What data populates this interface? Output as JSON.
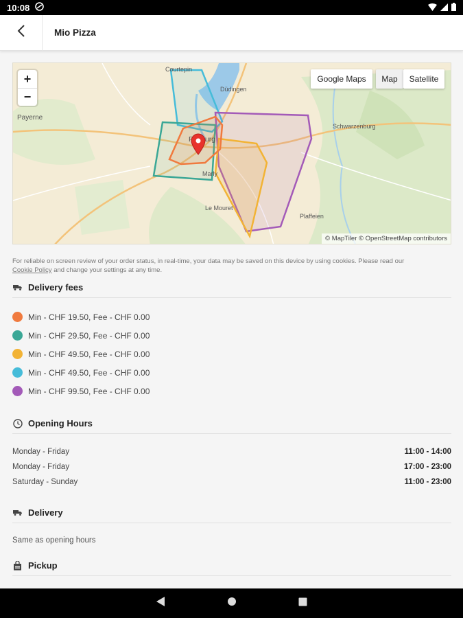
{
  "status_bar": {
    "time": "10:08"
  },
  "app_bar": {
    "title": "Mio Pizza"
  },
  "map": {
    "zoom_in": "+",
    "zoom_out": "−",
    "google_maps_label": "Google Maps",
    "map_label": "Map",
    "satellite_label": "Satellite",
    "attribution": "© MapTiler © OpenStreetMap contributors",
    "places": {
      "courtepin": "Courtepin",
      "dudingen": "Düdingen",
      "payerne": "Payerne",
      "schwarzenburg": "Schwarzenburg",
      "fribourg": "Fribourg",
      "marly": "Marly",
      "le_mouret": "Le Mouret",
      "plaffeien": "Plaffeien"
    }
  },
  "cookie_notice": {
    "text_before": "For reliable on screen review of your order status, in real-time, your data may be saved on this device by using cookies. Please read our",
    "link": "Cookie Policy",
    "text_after": "and change your settings at any time."
  },
  "delivery_fees": {
    "title": "Delivery fees",
    "items": [
      {
        "label": "Min - CHF 19.50, Fee - CHF 0.00",
        "color": "#f07a3e"
      },
      {
        "label": "Min - CHF 29.50, Fee - CHF 0.00",
        "color": "#3aa796"
      },
      {
        "label": "Min - CHF 49.50, Fee - CHF 0.00",
        "color": "#f2b335"
      },
      {
        "label": "Min - CHF 49.50, Fee - CHF 0.00",
        "color": "#46bcd9"
      },
      {
        "label": "Min - CHF 99.50, Fee - CHF 0.00",
        "color": "#a35ab8"
      }
    ]
  },
  "opening_hours": {
    "title": "Opening Hours",
    "rows": [
      {
        "days": "Monday - Friday",
        "time": "11:00 - 14:00"
      },
      {
        "days": "Monday - Friday",
        "time": "17:00 - 23:00"
      },
      {
        "days": "Saturday - Sunday",
        "time": "11:00 - 23:00"
      }
    ]
  },
  "delivery": {
    "title": "Delivery",
    "text": "Same as opening hours"
  },
  "pickup": {
    "title": "Pickup"
  }
}
